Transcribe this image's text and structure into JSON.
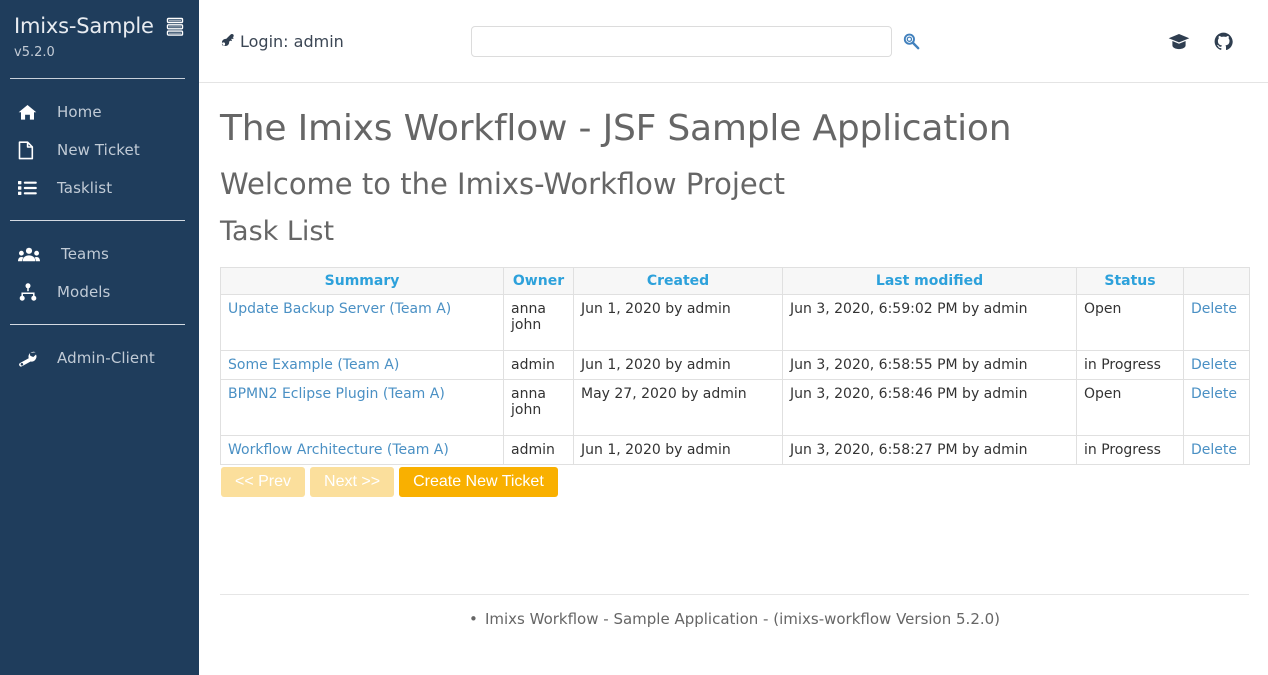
{
  "sidebar": {
    "brand": "Imixs-Sample",
    "brand_icon": "layers-icon",
    "version": "v5.2.0",
    "groups": [
      {
        "items": [
          {
            "label": "Home",
            "icon": "home-icon",
            "name": "home"
          },
          {
            "label": "New Ticket",
            "icon": "document-icon",
            "name": "new-ticket"
          },
          {
            "label": "Tasklist",
            "icon": "list-icon",
            "name": "tasklist"
          }
        ]
      },
      {
        "items": [
          {
            "label": "Teams",
            "icon": "users-icon",
            "name": "teams"
          },
          {
            "label": "Models",
            "icon": "sitemap-icon",
            "name": "models"
          }
        ]
      },
      {
        "items": [
          {
            "label": "Admin-Client",
            "icon": "wrench-icon",
            "name": "admin-client"
          }
        ]
      }
    ]
  },
  "topbar": {
    "login_icon": "key-icon",
    "login_label": "Login: admin",
    "search": {
      "value": "",
      "placeholder": ""
    },
    "search_icon": "search-icon",
    "icons": [
      {
        "name": "graduation-cap-icon"
      },
      {
        "name": "github-icon"
      }
    ]
  },
  "content": {
    "title": "The Imixs Workflow - JSF Sample Application",
    "subtitle": "Welcome to the Imixs-Workflow Project",
    "section": "Task List"
  },
  "table": {
    "columns": [
      "Summary",
      "Owner",
      "Created",
      "Last modified",
      "Status",
      ""
    ],
    "rows": [
      {
        "summary": "Update Backup Server (Team A)",
        "owner": "anna john",
        "created": "Jun 1, 2020 by admin",
        "modified": "Jun 3, 2020, 6:59:02 PM by admin",
        "status": "Open",
        "action": "Delete"
      },
      {
        "summary": "Some Example (Team A)",
        "owner": "admin",
        "created": "Jun 1, 2020 by admin",
        "modified": "Jun 3, 2020, 6:58:55 PM by admin",
        "status": "in Progress",
        "action": "Delete"
      },
      {
        "summary": "BPMN2 Eclipse Plugin (Team A)",
        "owner": "anna john",
        "created": "May 27, 2020 by admin",
        "modified": "Jun 3, 2020, 6:58:46 PM by admin",
        "status": "Open",
        "action": "Delete"
      },
      {
        "summary": "Workflow Architecture (Team A)",
        "owner": "admin",
        "created": "Jun 1, 2020 by admin",
        "modified": "Jun 3, 2020, 6:58:27 PM by admin",
        "status": "in Progress",
        "action": "Delete"
      }
    ]
  },
  "buttons": {
    "prev": "<< Prev",
    "next": "Next >>",
    "create": "Create New Ticket"
  },
  "footer": {
    "text": "Imixs Workflow - Sample Application - (imixs-workflow Version 5.2.0)"
  },
  "colors": {
    "sidebar_bg": "#1f3d5c",
    "link_blue": "#4a90c4",
    "header_blue": "#2da1db",
    "btn_primary": "#f9b000",
    "btn_disabled": "#fbdf9c",
    "heading_gray": "#666666"
  }
}
